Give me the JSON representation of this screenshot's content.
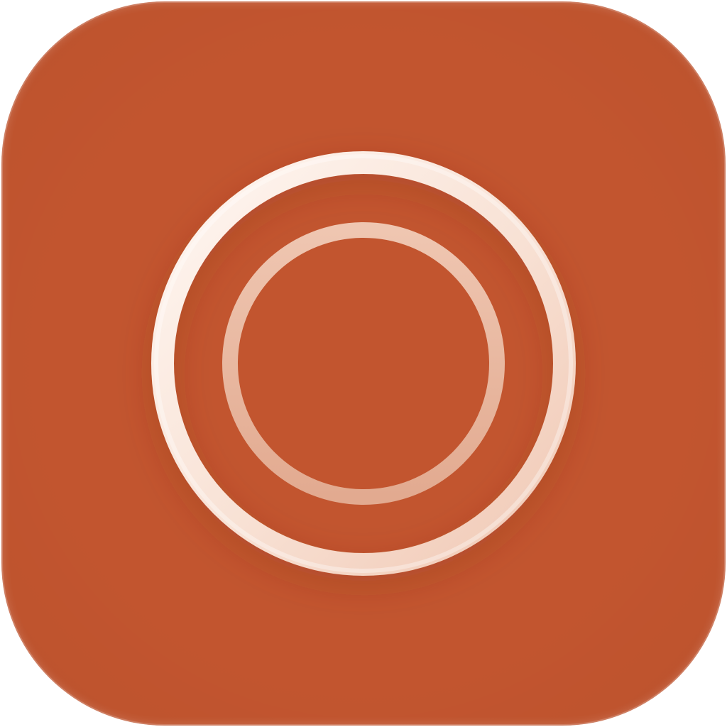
{
  "icon": {
    "name": "circle-target-app-icon",
    "glyph": "concentric-rings-icon"
  },
  "colors": {
    "tile": "#c2552f",
    "outer_ring": "#fbe8dc",
    "inner_ring": "#e9b8a1"
  }
}
